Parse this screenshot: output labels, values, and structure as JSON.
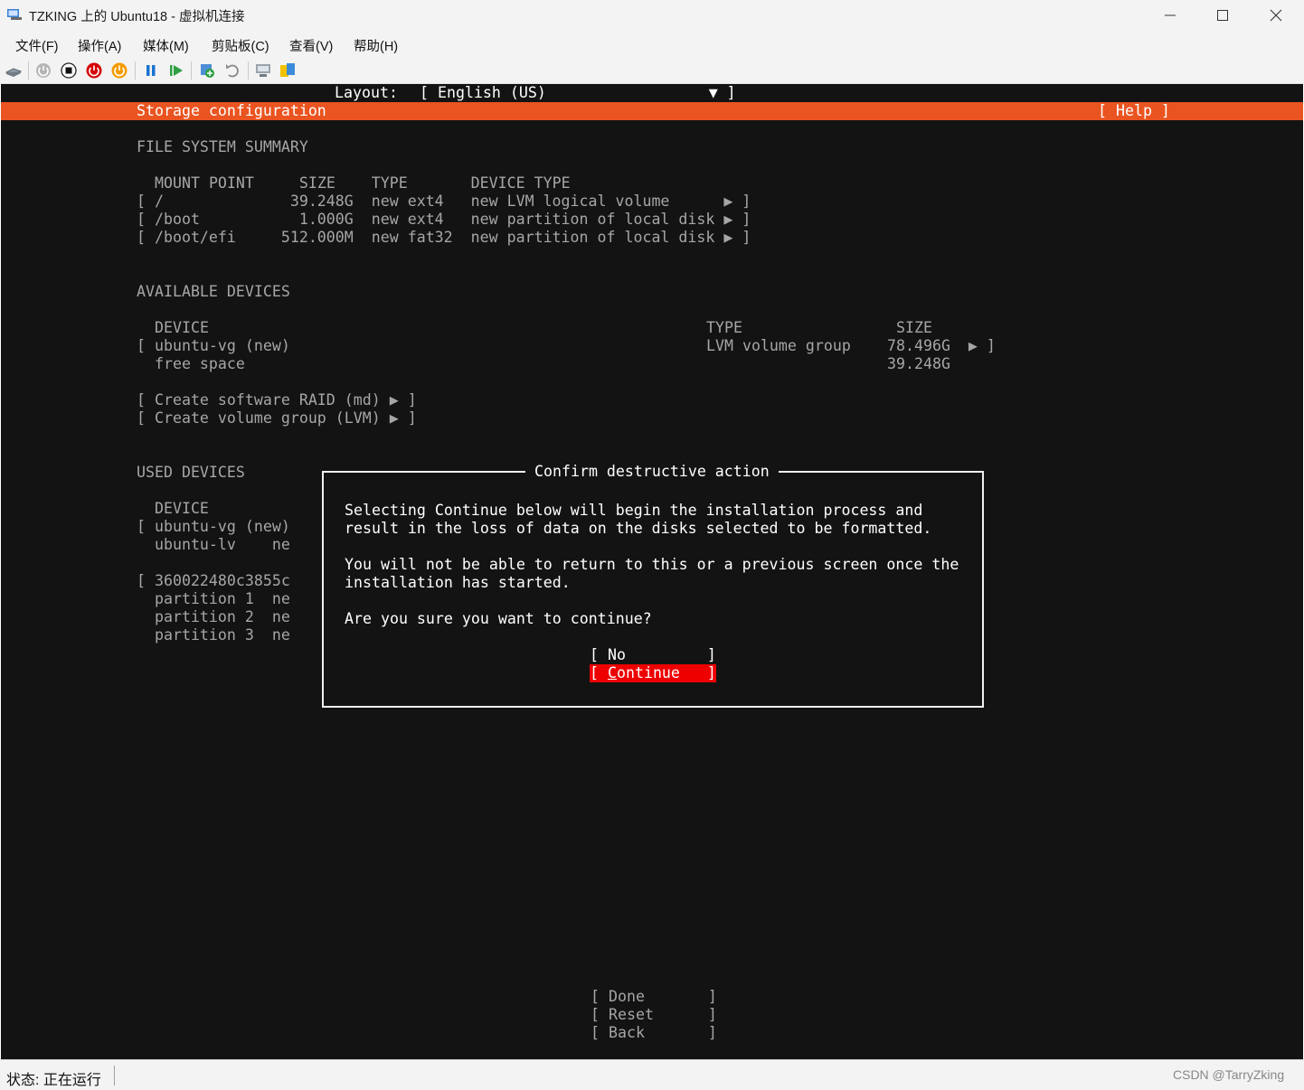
{
  "window": {
    "title": "TZKING 上的 Ubuntu18 - 虚拟机连接"
  },
  "menu": [
    "文件(F)",
    "操作(A)",
    "媒体(M)",
    "剪贴板(C)",
    "查看(V)",
    "帮助(H)"
  ],
  "toolbar_icons": [
    "ctrl-alt-del-icon",
    "start-icon",
    "turn-off-icon",
    "shutdown-icon",
    "save-icon",
    "pause-icon",
    "resume-icon",
    "checkpoint-icon",
    "revert-icon",
    "enhanced-session-icon",
    "share-icon"
  ],
  "installer": {
    "layout_label": "Layout:",
    "layout_value": "[ English (US)                  ▼ ]",
    "header_title": "Storage configuration",
    "help_button": "[ Help ]",
    "fs_summary": {
      "heading": "FILE SYSTEM SUMMARY",
      "columns": "MOUNT POINT     SIZE    TYPE       DEVICE TYPE",
      "rows": [
        "[ /              39.248G  new ext4   new LVM logical volume      ▶ ]",
        "[ /boot           1.000G  new ext4   new partition of local disk ▶ ]",
        "[ /boot/efi     512.000M  new fat32  new partition of local disk ▶ ]"
      ]
    },
    "available": {
      "heading": "AVAILABLE DEVICES",
      "col_device": "DEVICE",
      "col_type": "TYPE",
      "col_size": "SIZE",
      "row1_device": "[ ubuntu-vg (new)",
      "row1_type": "LVM volume group",
      "row1_size": "78.496G  ▶ ]",
      "row2_device": "  free space",
      "row2_size": "39.248G",
      "raid": "[ Create software RAID (md) ▶ ]",
      "lvm": "[ Create volume group (LVM) ▶ ]"
    },
    "used": {
      "heading": "USED DEVICES",
      "lines": [
        "  DEVICE",
        "[ ubuntu-vg (new)",
        "  ubuntu-lv    ne",
        "",
        "[ 360022480c3855c",
        "  partition 1  ne",
        "  partition 2  ne",
        "  partition 3  ne"
      ]
    },
    "bottom_buttons": [
      "[ Done       ]",
      "[ Reset      ]",
      "[ Back       ]"
    ]
  },
  "dialog": {
    "title": "Confirm destructive action",
    "line1": "Selecting Continue below will begin the installation process and",
    "line2": "result in the loss of data on the disks selected to be formatted.",
    "line3": "You will not be able to return to this or a previous screen once the",
    "line4": "installation has started.",
    "question": "Are you sure you want to continue?",
    "no_button": "[ No         ]",
    "continue_prefix": "[ ",
    "continue_cursor": "C",
    "continue_rest": "ontinue   ]"
  },
  "status": {
    "text": "状态: 正在运行",
    "watermark": "CSDN @TarryZking"
  }
}
